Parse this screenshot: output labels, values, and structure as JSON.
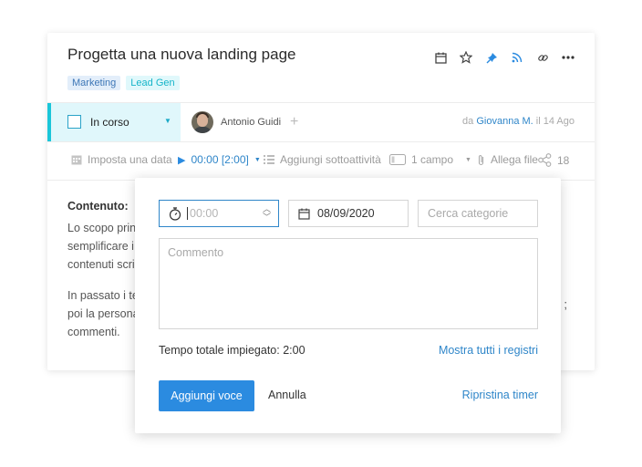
{
  "task": {
    "title": "Progetta una nuova landing page",
    "tags": [
      "Marketing",
      "Lead Gen"
    ],
    "status": "In corso",
    "assignee": "Antonio Guidi",
    "meta_prefix": "da",
    "meta_author": "Giovanna M.",
    "meta_date": "il 14 Ago"
  },
  "actions": {
    "set_date": "Imposta una data",
    "timer": "00:00 [2:00]",
    "add_subtask": "Aggiungi sottoattività",
    "fields": "1 campo",
    "attach": "Allega file",
    "share_count": "18"
  },
  "content": {
    "heading": "Contenuto:",
    "line1": "Lo scopo prin",
    "line2": "semplificare i",
    "line3": "contenuti scri",
    "line4": "In passato i te",
    "line5": "poi la persona",
    "line6": "commenti.",
    "trailing": ";"
  },
  "popup": {
    "time_placeholder": "00:00",
    "date_value": "08/09/2020",
    "category_placeholder": "Cerca categorie",
    "comment_placeholder": "Commento",
    "total_label": "Tempo totale impiegato: 2:00",
    "show_all": "Mostra tutti i registri",
    "add_button": "Aggiungi voce",
    "cancel": "Annulla",
    "reset": "Ripristina timer"
  },
  "colors": {
    "accent": "#2b8be0",
    "status_bg": "#e0f7fb",
    "status_border": "#1ac6d9"
  },
  "icons": [
    "calendar-icon",
    "star-icon",
    "pin-icon",
    "rss-icon",
    "link-icon",
    "more-icon"
  ]
}
